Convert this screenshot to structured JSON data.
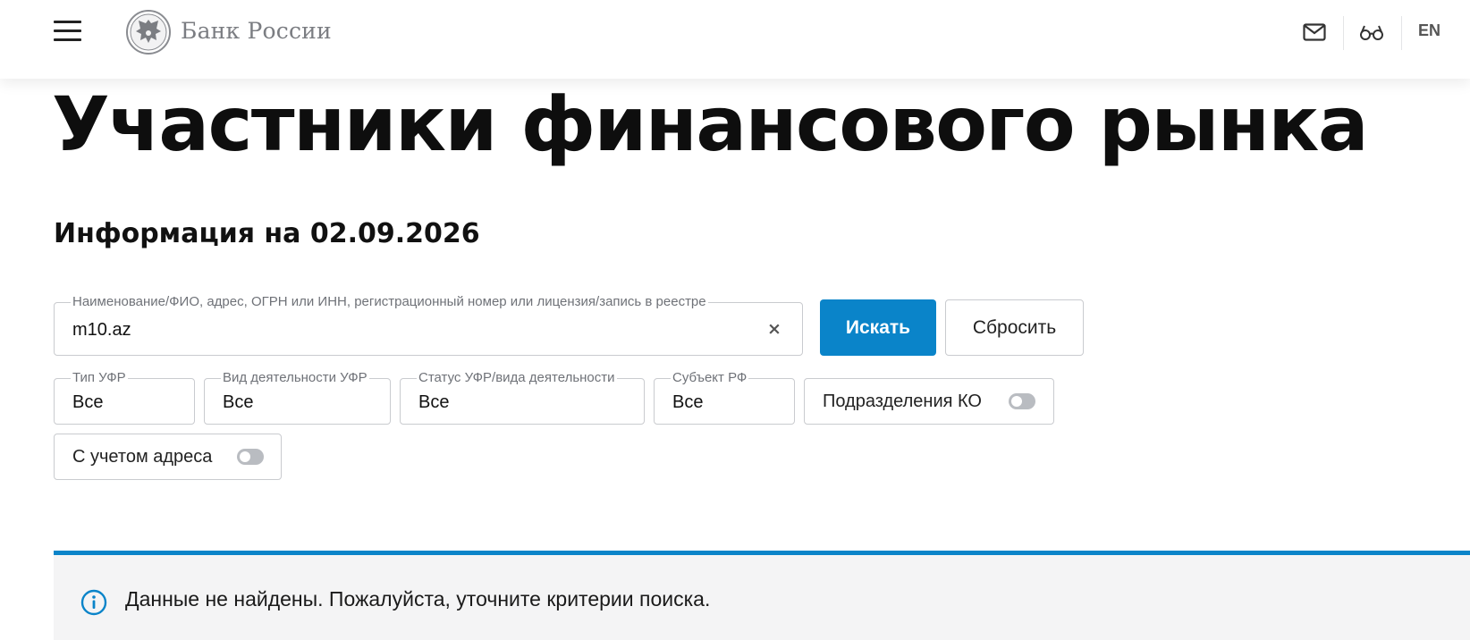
{
  "header": {
    "brand": "Банк России",
    "lang": "EN",
    "icons": [
      "menu-icon",
      "logo-emblem",
      "mail-icon",
      "glasses-icon"
    ]
  },
  "page": {
    "title": "Участники финансового рынка",
    "subtitle": "Информация на 02.09.2026"
  },
  "search": {
    "label": "Наименование/ФИО, адрес, ОГРН или ИНН, регистрационный номер или лицензия/запись в реестре",
    "value": "m10.az",
    "clear_icon": "×",
    "submit_label": "Искать",
    "reset_label": "Сбросить"
  },
  "filters": [
    {
      "label": "Тип УФР",
      "value": "Все"
    },
    {
      "label": "Вид деятельности УФР",
      "value": "Все"
    },
    {
      "label": "Статус УФР/вида деятельности",
      "value": "Все"
    },
    {
      "label": "Субъект РФ",
      "value": "Все"
    }
  ],
  "toggles": {
    "branches": {
      "label": "Подразделения КО",
      "on": false
    },
    "address": {
      "label": "С учетом адреса",
      "on": false
    }
  },
  "alert": {
    "icon": "info-icon",
    "text": "Данные не найдены. Пожалуйста, уточните критерии поиска."
  },
  "colors": {
    "accent": "#0a84c9",
    "alert_bg": "#f4f4f5",
    "border": "#c9cbcf"
  }
}
